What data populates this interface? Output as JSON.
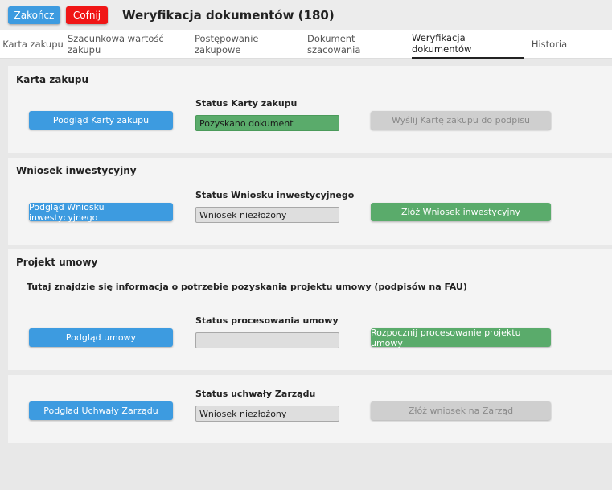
{
  "header": {
    "finish_label": "Zakończ",
    "back_label": "Cofnij",
    "title": "Weryfikacja dokumentów (180)"
  },
  "tabs": [
    {
      "label": "Karta zakupu",
      "active": false
    },
    {
      "label": "Szacunkowa wartość zakupu",
      "active": false
    },
    {
      "label": "Postępowanie zakupowe",
      "active": false
    },
    {
      "label": "Dokument szacowania",
      "active": false
    },
    {
      "label": "Weryfikacja dokumentów",
      "active": true
    },
    {
      "label": "Historia",
      "active": false
    }
  ],
  "sections": {
    "karta": {
      "title": "Karta zakupu",
      "preview_label": "Podgląd Karty zakupu",
      "status_label": "Status Karty zakupu",
      "status_value": "Pozyskano dokument",
      "action_label": "Wyślij Kartę zakupu do podpisu"
    },
    "wniosek": {
      "title": "Wniosek inwestycyjny",
      "preview_label": "Podgląd Wniosku inwestycyjnego",
      "status_label": "Status Wniosku inwestycyjnego",
      "status_value": "Wniosek niezłożony",
      "action_label": "Złóż Wniosek inwestycyjny"
    },
    "umowa": {
      "title": "Projekt umowy",
      "info": "Tutaj znajdzie się informacja o potrzebie pozyskania projektu umowy (podpisów na FAU)",
      "preview_label": "Podgląd umowy",
      "status_label": "Status procesowania umowy",
      "status_value": "",
      "action_label": "Rozpocznij procesowanie projektu umowy"
    },
    "uchwala": {
      "preview_label": "Podglad Uchwały Zarządu",
      "status_label": "Status uchwały Zarządu",
      "status_value": "Wniosek niezłożony",
      "action_label": "Złóż wniosek na Zarząd"
    }
  },
  "colors": {
    "primary_blue": "#3d9be0",
    "danger_red": "#f01515",
    "success_green": "#5aab6b",
    "disabled_gray": "#cfcfcf"
  }
}
